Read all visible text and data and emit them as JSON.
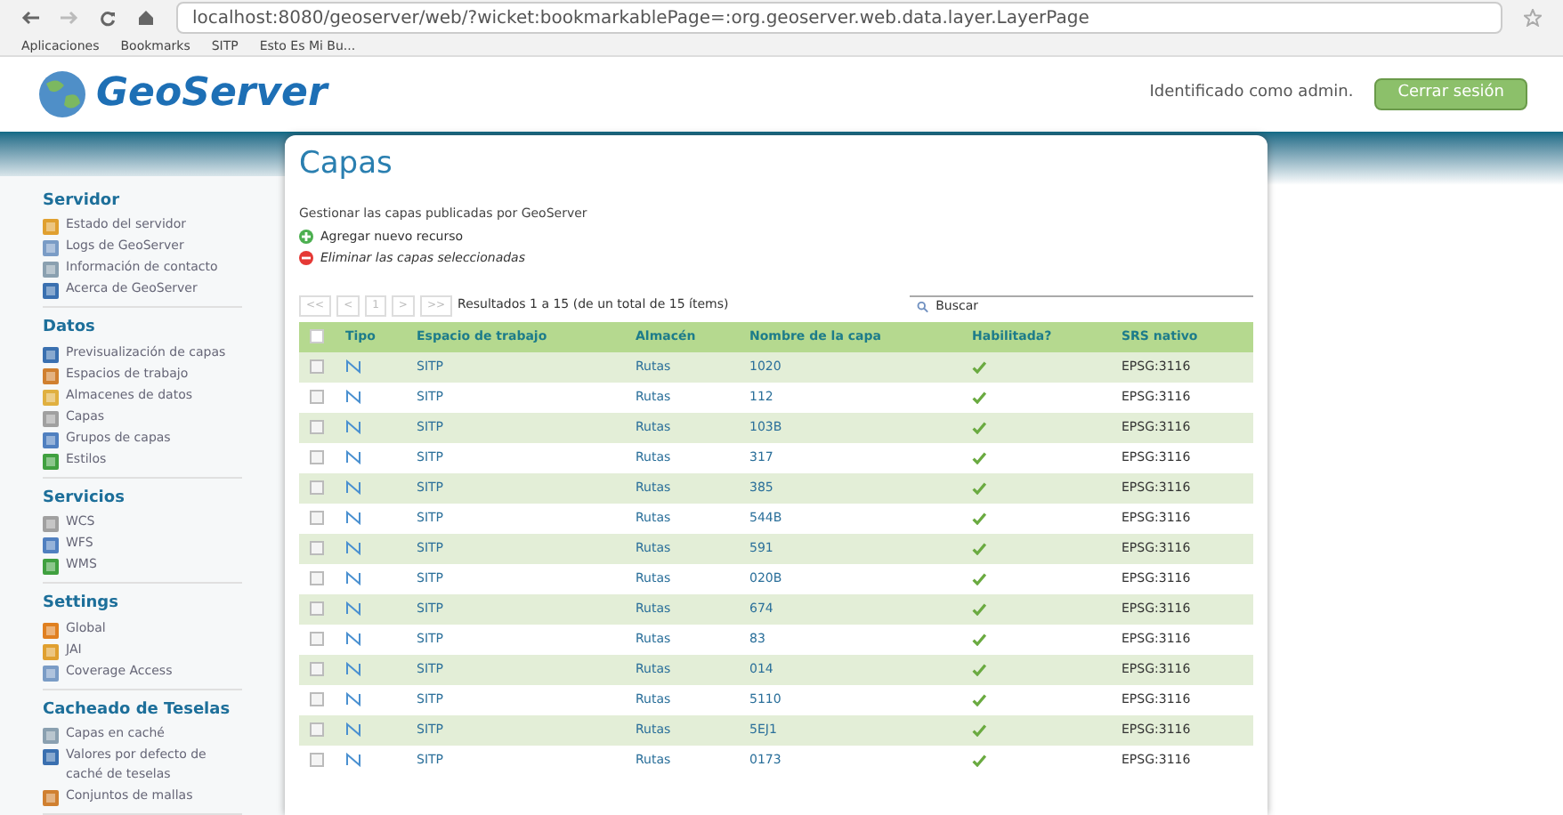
{
  "browser": {
    "address": "localhost:8080/geoserver/web/?wicket:bookmarkablePage=:org.geoserver.web.data.layer.LayerPage",
    "bookmarks": [
      "Aplicaciones",
      "Bookmarks",
      "SITP",
      "Esto Es Mi Bu..."
    ]
  },
  "header": {
    "logo": "GeoServer",
    "user": "Identificado como admin.",
    "logout": "Cerrar sesión"
  },
  "sidebar": [
    {
      "title": "Servidor",
      "items": [
        "Estado del servidor",
        "Logs de GeoServer",
        "Información de contacto",
        "Acerca de GeoServer"
      ]
    },
    {
      "title": "Datos",
      "items": [
        "Previsualización de capas",
        "Espacios de trabajo",
        "Almacenes de datos",
        "Capas",
        "Grupos de capas",
        "Estilos"
      ]
    },
    {
      "title": "Servicios",
      "items": [
        "WCS",
        "WFS",
        "WMS"
      ]
    },
    {
      "title": "Settings",
      "items": [
        "Global",
        "JAI",
        "Coverage Access"
      ]
    },
    {
      "title": "Cacheado de Teselas",
      "items": [
        "Capas en caché",
        "Valores por defecto de caché de teselas",
        "Conjuntos de mallas"
      ]
    }
  ],
  "page": {
    "title": "Capas",
    "description": "Gestionar las capas publicadas por GeoServer",
    "actions": [
      {
        "kind": "add",
        "label": "Agregar nuevo recurso"
      },
      {
        "kind": "remove",
        "label": "Eliminar las capas seleccionadas"
      }
    ]
  },
  "pager": {
    "buttons": [
      "<<",
      "<",
      "1",
      ">",
      ">>"
    ],
    "summary": "Resultados 1 a 15 (de un total de 15 ítems)"
  },
  "search": {
    "placeholder": "Buscar"
  },
  "table": {
    "select_all_checked": false,
    "columns": [
      "Tipo",
      "Espacio de trabajo",
      "Almacén",
      "Nombre de la capa",
      "Habilitada?",
      "SRS nativo"
    ],
    "rows": [
      {
        "workspace": "SITP",
        "store": "Rutas",
        "name": "1020",
        "enabled": true,
        "srs": "EPSG:3116",
        "checked": false
      },
      {
        "workspace": "SITP",
        "store": "Rutas",
        "name": "112",
        "enabled": true,
        "srs": "EPSG:3116",
        "checked": false
      },
      {
        "workspace": "SITP",
        "store": "Rutas",
        "name": "103B",
        "enabled": true,
        "srs": "EPSG:3116",
        "checked": false
      },
      {
        "workspace": "SITP",
        "store": "Rutas",
        "name": "317",
        "enabled": true,
        "srs": "EPSG:3116",
        "checked": false
      },
      {
        "workspace": "SITP",
        "store": "Rutas",
        "name": "385",
        "enabled": true,
        "srs": "EPSG:3116",
        "checked": false
      },
      {
        "workspace": "SITP",
        "store": "Rutas",
        "name": "544B",
        "enabled": true,
        "srs": "EPSG:3116",
        "checked": false
      },
      {
        "workspace": "SITP",
        "store": "Rutas",
        "name": "591",
        "enabled": true,
        "srs": "EPSG:3116",
        "checked": false
      },
      {
        "workspace": "SITP",
        "store": "Rutas",
        "name": "020B",
        "enabled": true,
        "srs": "EPSG:3116",
        "checked": false
      },
      {
        "workspace": "SITP",
        "store": "Rutas",
        "name": "674",
        "enabled": true,
        "srs": "EPSG:3116",
        "checked": false
      },
      {
        "workspace": "SITP",
        "store": "Rutas",
        "name": "83",
        "enabled": true,
        "srs": "EPSG:3116",
        "checked": false
      },
      {
        "workspace": "SITP",
        "store": "Rutas",
        "name": "014",
        "enabled": true,
        "srs": "EPSG:3116",
        "checked": false
      },
      {
        "workspace": "SITP",
        "store": "Rutas",
        "name": "5110",
        "enabled": true,
        "srs": "EPSG:3116",
        "checked": false
      },
      {
        "workspace": "SITP",
        "store": "Rutas",
        "name": "5EJ1",
        "enabled": true,
        "srs": "EPSG:3116",
        "checked": false
      },
      {
        "workspace": "SITP",
        "store": "Rutas",
        "name": "0173",
        "enabled": true,
        "srs": "EPSG:3116",
        "checked": false
      }
    ]
  }
}
